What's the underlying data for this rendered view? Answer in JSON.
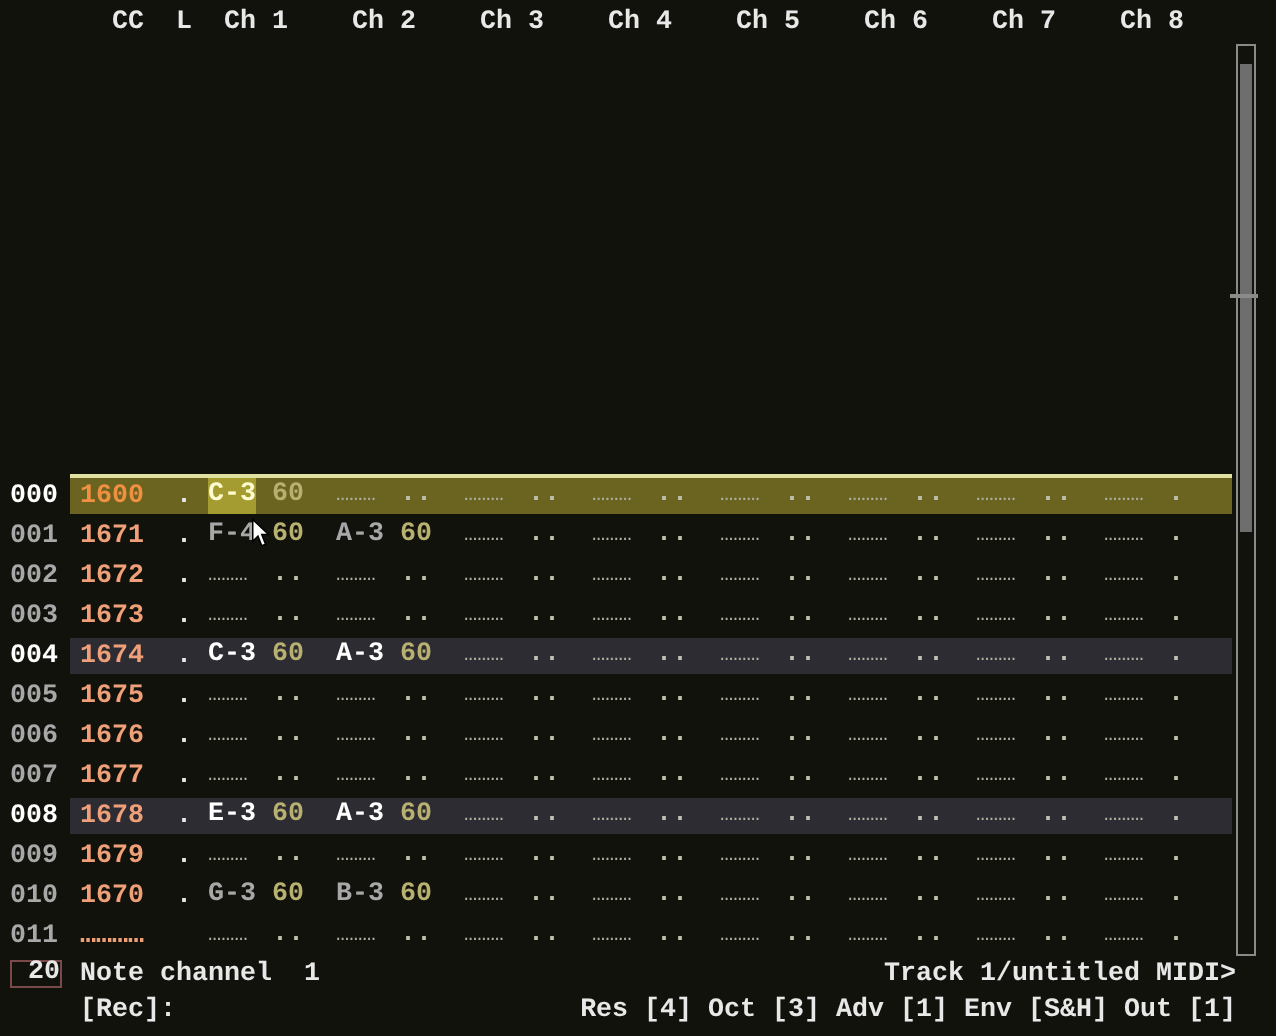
{
  "header": {
    "columns": [
      "CC",
      "L",
      "Ch 1",
      "Ch 2",
      "Ch 3",
      "Ch 4",
      "Ch 5",
      "Ch 6",
      "Ch 7",
      "Ch 8"
    ]
  },
  "rows": [
    {
      "number": "000",
      "cc": "1600",
      "loop": ".",
      "kind": "cursor",
      "cells": [
        {
          "note": "C-3",
          "velocity": "60",
          "selected": true
        },
        {
          "note": "………",
          "velocity": "..",
          "selected": false
        },
        {
          "note": "………",
          "velocity": "..",
          "selected": false
        },
        {
          "note": "………",
          "velocity": "..",
          "selected": false
        },
        {
          "note": "………",
          "velocity": "..",
          "selected": false
        },
        {
          "note": "………",
          "velocity": "..",
          "selected": false
        },
        {
          "note": "………",
          "velocity": "..",
          "selected": false
        },
        {
          "note": "………",
          "velocity": ".",
          "selected": false
        }
      ]
    },
    {
      "number": "001",
      "cc": "1671",
      "loop": ".",
      "kind": "normal",
      "cells": [
        {
          "note": "F-4",
          "velocity": "60",
          "selected": false
        },
        {
          "note": "A-3",
          "velocity": "60",
          "selected": false
        },
        {
          "note": "………",
          "velocity": "..",
          "selected": false
        },
        {
          "note": "………",
          "velocity": "..",
          "selected": false
        },
        {
          "note": "………",
          "velocity": "..",
          "selected": false
        },
        {
          "note": "………",
          "velocity": "..",
          "selected": false
        },
        {
          "note": "………",
          "velocity": "..",
          "selected": false
        },
        {
          "note": "………",
          "velocity": ".",
          "selected": false
        }
      ]
    },
    {
      "number": "002",
      "cc": "1672",
      "loop": ".",
      "kind": "normal",
      "cells": [
        {
          "note": "………",
          "velocity": "..",
          "selected": false
        },
        {
          "note": "………",
          "velocity": "..",
          "selected": false
        },
        {
          "note": "………",
          "velocity": "..",
          "selected": false
        },
        {
          "note": "………",
          "velocity": "..",
          "selected": false
        },
        {
          "note": "………",
          "velocity": "..",
          "selected": false
        },
        {
          "note": "………",
          "velocity": "..",
          "selected": false
        },
        {
          "note": "………",
          "velocity": "..",
          "selected": false
        },
        {
          "note": "………",
          "velocity": ".",
          "selected": false
        }
      ]
    },
    {
      "number": "003",
      "cc": "1673",
      "loop": ".",
      "kind": "normal",
      "cells": [
        {
          "note": "………",
          "velocity": "..",
          "selected": false
        },
        {
          "note": "………",
          "velocity": "..",
          "selected": false
        },
        {
          "note": "………",
          "velocity": "..",
          "selected": false
        },
        {
          "note": "………",
          "velocity": "..",
          "selected": false
        },
        {
          "note": "………",
          "velocity": "..",
          "selected": false
        },
        {
          "note": "………",
          "velocity": "..",
          "selected": false
        },
        {
          "note": "………",
          "velocity": "..",
          "selected": false
        },
        {
          "note": "………",
          "velocity": ".",
          "selected": false
        }
      ]
    },
    {
      "number": "004",
      "cc": "1674",
      "loop": ".",
      "kind": "beat",
      "cells": [
        {
          "note": "C-3",
          "velocity": "60",
          "selected": false
        },
        {
          "note": "A-3",
          "velocity": "60",
          "selected": false
        },
        {
          "note": "………",
          "velocity": "..",
          "selected": false
        },
        {
          "note": "………",
          "velocity": "..",
          "selected": false
        },
        {
          "note": "………",
          "velocity": "..",
          "selected": false
        },
        {
          "note": "………",
          "velocity": "..",
          "selected": false
        },
        {
          "note": "………",
          "velocity": "..",
          "selected": false
        },
        {
          "note": "………",
          "velocity": ".",
          "selected": false
        }
      ]
    },
    {
      "number": "005",
      "cc": "1675",
      "loop": ".",
      "kind": "normal",
      "cells": [
        {
          "note": "………",
          "velocity": "..",
          "selected": false
        },
        {
          "note": "………",
          "velocity": "..",
          "selected": false
        },
        {
          "note": "………",
          "velocity": "..",
          "selected": false
        },
        {
          "note": "………",
          "velocity": "..",
          "selected": false
        },
        {
          "note": "………",
          "velocity": "..",
          "selected": false
        },
        {
          "note": "………",
          "velocity": "..",
          "selected": false
        },
        {
          "note": "………",
          "velocity": "..",
          "selected": false
        },
        {
          "note": "………",
          "velocity": ".",
          "selected": false
        }
      ]
    },
    {
      "number": "006",
      "cc": "1676",
      "loop": ".",
      "kind": "normal",
      "cells": [
        {
          "note": "………",
          "velocity": "..",
          "selected": false
        },
        {
          "note": "………",
          "velocity": "..",
          "selected": false
        },
        {
          "note": "………",
          "velocity": "..",
          "selected": false
        },
        {
          "note": "………",
          "velocity": "..",
          "selected": false
        },
        {
          "note": "………",
          "velocity": "..",
          "selected": false
        },
        {
          "note": "………",
          "velocity": "..",
          "selected": false
        },
        {
          "note": "………",
          "velocity": "..",
          "selected": false
        },
        {
          "note": "………",
          "velocity": ".",
          "selected": false
        }
      ]
    },
    {
      "number": "007",
      "cc": "1677",
      "loop": ".",
      "kind": "normal",
      "cells": [
        {
          "note": "………",
          "velocity": "..",
          "selected": false
        },
        {
          "note": "………",
          "velocity": "..",
          "selected": false
        },
        {
          "note": "………",
          "velocity": "..",
          "selected": false
        },
        {
          "note": "………",
          "velocity": "..",
          "selected": false
        },
        {
          "note": "………",
          "velocity": "..",
          "selected": false
        },
        {
          "note": "………",
          "velocity": "..",
          "selected": false
        },
        {
          "note": "………",
          "velocity": "..",
          "selected": false
        },
        {
          "note": "………",
          "velocity": ".",
          "selected": false
        }
      ]
    },
    {
      "number": "008",
      "cc": "1678",
      "loop": ".",
      "kind": "beat",
      "cells": [
        {
          "note": "E-3",
          "velocity": "60",
          "selected": false
        },
        {
          "note": "A-3",
          "velocity": "60",
          "selected": false
        },
        {
          "note": "………",
          "velocity": "..",
          "selected": false
        },
        {
          "note": "………",
          "velocity": "..",
          "selected": false
        },
        {
          "note": "………",
          "velocity": "..",
          "selected": false
        },
        {
          "note": "………",
          "velocity": "..",
          "selected": false
        },
        {
          "note": "………",
          "velocity": "..",
          "selected": false
        },
        {
          "note": "………",
          "velocity": ".",
          "selected": false
        }
      ]
    },
    {
      "number": "009",
      "cc": "1679",
      "loop": ".",
      "kind": "normal",
      "cells": [
        {
          "note": "………",
          "velocity": "..",
          "selected": false
        },
        {
          "note": "………",
          "velocity": "..",
          "selected": false
        },
        {
          "note": "………",
          "velocity": "..",
          "selected": false
        },
        {
          "note": "………",
          "velocity": "..",
          "selected": false
        },
        {
          "note": "………",
          "velocity": "..",
          "selected": false
        },
        {
          "note": "………",
          "velocity": "..",
          "selected": false
        },
        {
          "note": "………",
          "velocity": "..",
          "selected": false
        },
        {
          "note": "………",
          "velocity": ".",
          "selected": false
        }
      ]
    },
    {
      "number": "010",
      "cc": "1670",
      "loop": ".",
      "kind": "normal",
      "cells": [
        {
          "note": "G-3",
          "velocity": "60",
          "selected": false
        },
        {
          "note": "B-3",
          "velocity": "60",
          "selected": false
        },
        {
          "note": "………",
          "velocity": "..",
          "selected": false
        },
        {
          "note": "………",
          "velocity": "..",
          "selected": false
        },
        {
          "note": "………",
          "velocity": "..",
          "selected": false
        },
        {
          "note": "………",
          "velocity": "..",
          "selected": false
        },
        {
          "note": "………",
          "velocity": "..",
          "selected": false
        },
        {
          "note": "………",
          "velocity": ".",
          "selected": false
        }
      ]
    },
    {
      "number": "011",
      "cc": "…………",
      "kind": "normal",
      "cells": [
        {
          "note": "………",
          "velocity": "..",
          "selected": false
        },
        {
          "note": "………",
          "velocity": "..",
          "selected": false
        },
        {
          "note": "………",
          "velocity": "..",
          "selected": false
        },
        {
          "note": "………",
          "velocity": "..",
          "selected": false
        },
        {
          "note": "………",
          "velocity": "..",
          "selected": false
        },
        {
          "note": "………",
          "velocity": "..",
          "selected": false
        },
        {
          "note": "………",
          "velocity": "..",
          "selected": false
        },
        {
          "note": "………",
          "velocity": ".",
          "selected": false
        }
      ]
    }
  ],
  "status_bar": {
    "value": "20",
    "label": "Note channel",
    "channel": "1",
    "track": "Track 1/untitled MIDI>",
    "mode": "[Rec]:",
    "settings": "Res [4] Oct [3] Adv [1] Env [S&H] Out [1]"
  }
}
